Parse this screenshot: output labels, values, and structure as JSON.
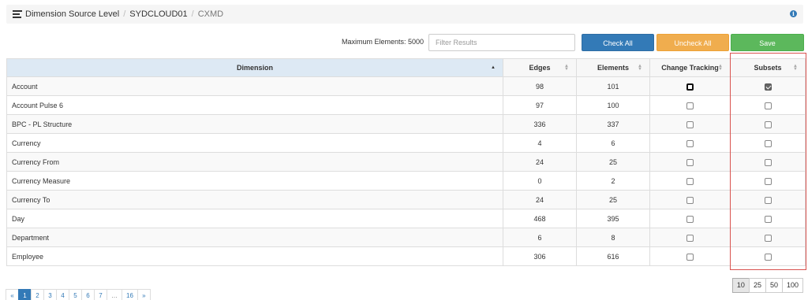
{
  "breadcrumb": {
    "items": [
      "Dimension Source Level",
      "SYDCLOUD01",
      "CXMD"
    ],
    "separator": "/"
  },
  "info_icon": {
    "glyph": "i",
    "color": "#337ab7"
  },
  "toolbar": {
    "max_elements_label": "Maximum Elements: 5000",
    "filter_placeholder": "Filter Results",
    "check_all": "Check All",
    "uncheck_all": "Uncheck All",
    "save": "Save"
  },
  "table": {
    "columns": [
      "Dimension",
      "Edges",
      "Elements",
      "Change Tracking",
      "Subsets"
    ],
    "sorted_column": "Dimension",
    "rows": [
      {
        "dimension": "Account",
        "edges": "98",
        "elements": "101",
        "change_tracking": false,
        "subsets": true
      },
      {
        "dimension": "Account Pulse 6",
        "edges": "97",
        "elements": "100",
        "change_tracking": false,
        "subsets": false
      },
      {
        "dimension": "BPC - PL Structure",
        "edges": "336",
        "elements": "337",
        "change_tracking": false,
        "subsets": false
      },
      {
        "dimension": "Currency",
        "edges": "4",
        "elements": "6",
        "change_tracking": false,
        "subsets": false
      },
      {
        "dimension": "Currency From",
        "edges": "24",
        "elements": "25",
        "change_tracking": false,
        "subsets": false
      },
      {
        "dimension": "Currency Measure",
        "edges": "0",
        "elements": "2",
        "change_tracking": false,
        "subsets": false
      },
      {
        "dimension": "Currency To",
        "edges": "24",
        "elements": "25",
        "change_tracking": false,
        "subsets": false
      },
      {
        "dimension": "Day",
        "edges": "468",
        "elements": "395",
        "change_tracking": false,
        "subsets": false
      },
      {
        "dimension": "Department",
        "edges": "6",
        "elements": "8",
        "change_tracking": false,
        "subsets": false
      },
      {
        "dimension": "Employee",
        "edges": "306",
        "elements": "616",
        "change_tracking": false,
        "subsets": false
      }
    ]
  },
  "pagination": {
    "pages": [
      "«",
      "1",
      "2",
      "3",
      "4",
      "5",
      "6",
      "7",
      "…",
      "16",
      "»"
    ],
    "active": "1"
  },
  "page_size": {
    "options": [
      "10",
      "25",
      "50",
      "100"
    ],
    "active": "10"
  },
  "colors": {
    "primary": "#337ab7",
    "warning": "#f0ad4e",
    "success": "#5cb85c",
    "highlight": "#d9534f"
  }
}
